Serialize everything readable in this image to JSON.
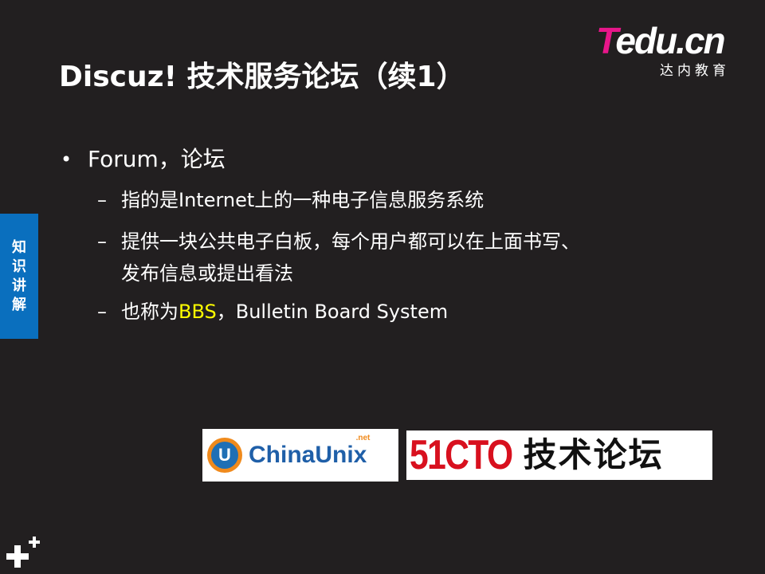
{
  "logo": {
    "brand_t": "T",
    "brand_rest": "edu.cn",
    "subtitle": "达内教育"
  },
  "slide": {
    "title": "Discuz! 技术服务论坛（续1）",
    "side_tab": "知识讲解",
    "bullet": {
      "marker": "•",
      "text": "Forum，论坛"
    },
    "subbullets": [
      {
        "marker": "–",
        "text": "指的是Internet上的一种电子信息服务系统"
      },
      {
        "marker": "–",
        "line1": "提供一块公共电子白板，每个用户都可以在上面书写、",
        "line2": "发布信息或提出看法"
      },
      {
        "marker": "–",
        "prefix": "也称为",
        "highlight": "BBS",
        "suffix": "，Bulletin Board System"
      }
    ]
  },
  "images": {
    "chinaunix": {
      "icon_letter": "U",
      "name": "ChinaUnix",
      "net": ".net"
    },
    "cto51": {
      "red": "51CTO",
      "cn": "技术论坛"
    }
  },
  "colors": {
    "background": "#221f20",
    "accent_blue": "#0a6fbe",
    "highlight": "#ffff00",
    "logo_pink": "#e8168a"
  }
}
